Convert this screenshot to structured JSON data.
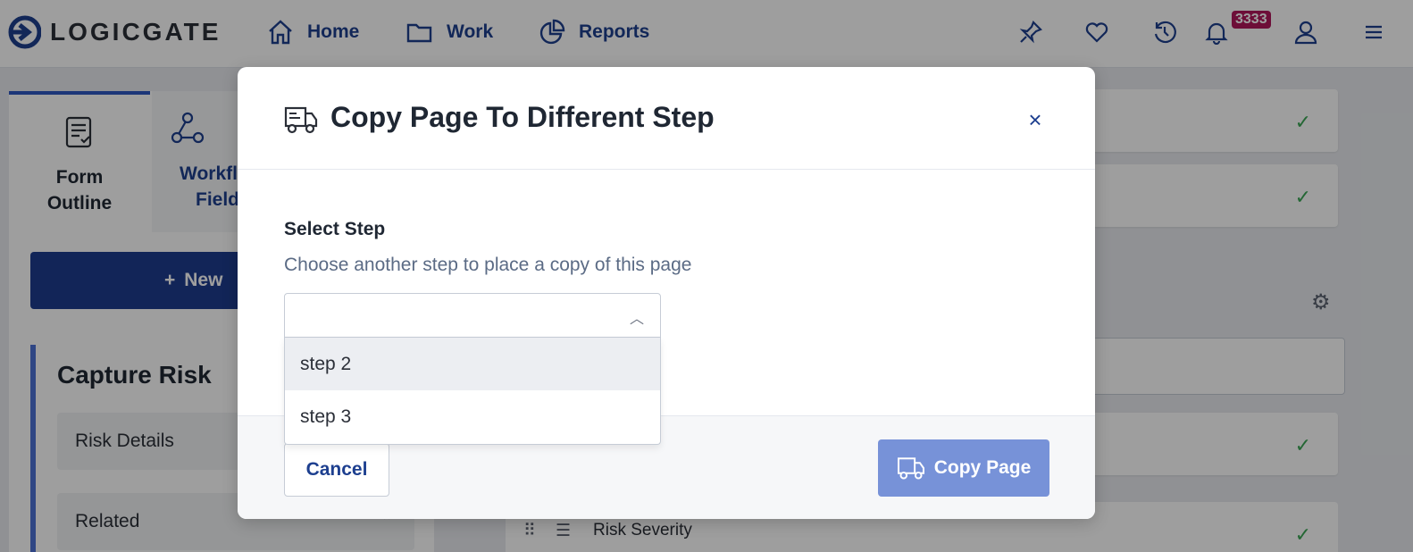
{
  "app": {
    "logo_text": "LOGICGATE",
    "nav": {
      "home": "Home",
      "work": "Work",
      "reports": "Reports"
    },
    "notifications_count": "3333"
  },
  "left_panel": {
    "tabs": [
      {
        "label_line1": "Form",
        "label_line2": "Outline"
      },
      {
        "label_line1": "Workfl",
        "label_line2": "Field"
      }
    ],
    "new_button_label": "New",
    "section_title": "Capture Risk",
    "items": [
      "Risk Details",
      "Related"
    ]
  },
  "right_panel": {
    "row_label": "Risk Severity"
  },
  "modal": {
    "title": "Copy Page To Different Step",
    "close_label": "×",
    "field_label": "Select Step",
    "field_help": "Choose another step to place a copy of this page",
    "select_value": "",
    "options": [
      "step 2",
      "step 3"
    ],
    "cancel_label": "Cancel",
    "copy_label": "Copy Page"
  }
}
